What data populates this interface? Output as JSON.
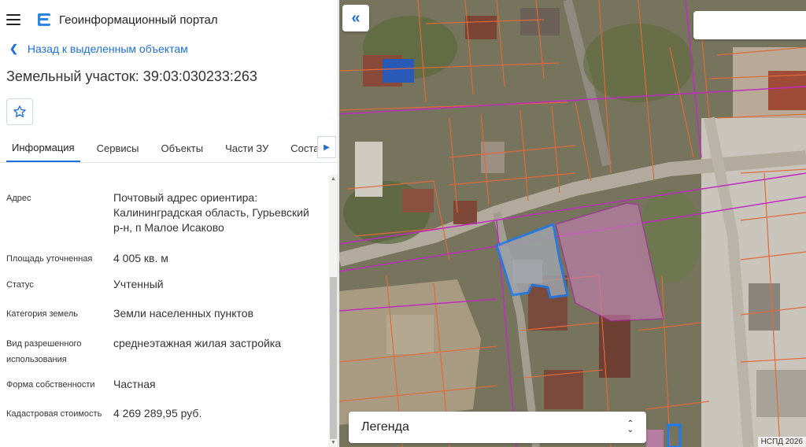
{
  "header": {
    "portal_title": "Геоинформационный портал"
  },
  "back_link": {
    "label": "Назад к выделенным объектам"
  },
  "object_title": "Земельный участок: 39:03:030233:263",
  "tabs": [
    {
      "label": "Информация",
      "active": true
    },
    {
      "label": "Сервисы"
    },
    {
      "label": "Объекты"
    },
    {
      "label": "Части ЗУ"
    },
    {
      "label": "Состав"
    }
  ],
  "details": [
    {
      "label": "Адрес",
      "value": "Почтовый адрес ориентира: Калининградская область, Гурьевский р-н, п Малое Исаково"
    },
    {
      "label": "Площадь уточненная",
      "value": "4 005 кв. м"
    },
    {
      "label": "Статус",
      "value": "Учтенный"
    },
    {
      "label": "Категория земель",
      "value": "Земли населенных пунктов"
    },
    {
      "label": "Вид разрешенного использования",
      "value": "среднеэтажная жилая застройка"
    },
    {
      "label": "Форма собственности",
      "value": "Частная"
    },
    {
      "label": "Кадастровая стоимость",
      "value": "4 269 289,95 руб."
    }
  ],
  "map": {
    "legend_label": "Легенда",
    "attribution": "НСПД 2026",
    "search_placeholder": "",
    "colors": {
      "parcel_border": "#e06a3a",
      "zone_border": "#c02cc0",
      "selected_border": "#1e7bf0",
      "zone_fill": "#c77fb4"
    }
  },
  "icons": [
    "menu-icon",
    "logo-icon",
    "chevron-left-icon",
    "star-icon",
    "chevron-right-icon",
    "double-chevron-left-icon",
    "sort-arrows-icon"
  ]
}
